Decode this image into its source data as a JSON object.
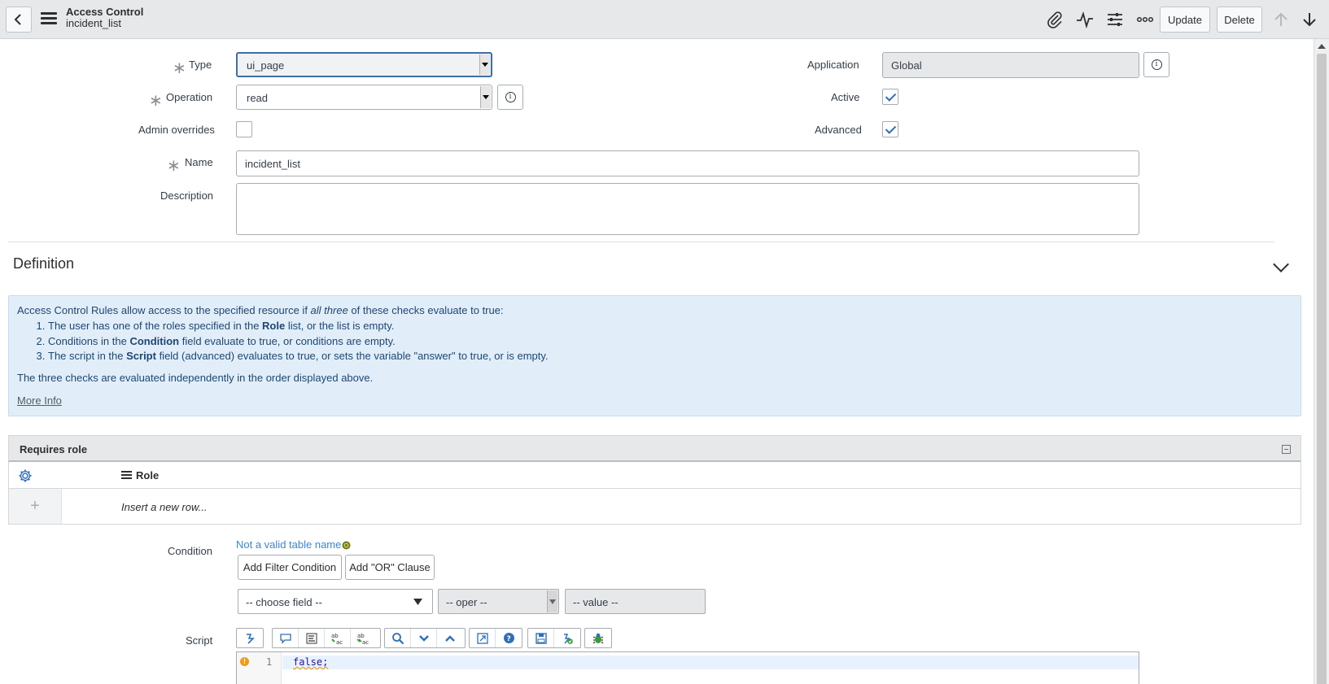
{
  "header": {
    "title": "Access Control",
    "subtitle": "incident_list",
    "update_label": "Update",
    "delete_label": "Delete"
  },
  "form": {
    "type": {
      "label": "Type",
      "value": "ui_page"
    },
    "operation": {
      "label": "Operation",
      "value": "read"
    },
    "admin_overrides": {
      "label": "Admin overrides",
      "checked": false
    },
    "name": {
      "label": "Name",
      "value": "incident_list"
    },
    "description": {
      "label": "Description",
      "value": ""
    },
    "application": {
      "label": "Application",
      "value": "Global"
    },
    "active": {
      "label": "Active",
      "checked": true
    },
    "advanced": {
      "label": "Advanced",
      "checked": true
    }
  },
  "definition": {
    "title": "Definition",
    "intro_pre": "Access Control Rules allow access to the specified resource if ",
    "intro_em": "all three",
    "intro_post": " of these checks evaluate to true:",
    "checks": [
      {
        "pre": "The user has one of the roles specified in the ",
        "bold": "Role",
        "post": " list, or the list is empty."
      },
      {
        "pre": "Conditions in the ",
        "bold": "Condition",
        "post": " field evaluate to true, or conditions are empty."
      },
      {
        "pre": "The script in the ",
        "bold": "Script",
        "post": " field (advanced) evaluates to true, or sets the variable \"answer\" to true, or is empty."
      }
    ],
    "note": "The three checks are evaluated independently in the order displayed above.",
    "more_info": "More Info"
  },
  "requires_role": {
    "title": "Requires role",
    "column": "Role",
    "insert_row": "Insert a new row..."
  },
  "condition": {
    "label": "Condition",
    "warning": "Not a valid table name",
    "add_filter": "Add Filter Condition",
    "add_or": "Add \"OR\" Clause",
    "field_placeholder": "-- choose field --",
    "oper_placeholder": "-- oper --",
    "value_placeholder": "-- value --"
  },
  "script": {
    "label": "Script",
    "line_number": "1",
    "code": "false;"
  },
  "icons": {
    "back": "back-arrow-icon",
    "menu": "hamburger-menu-icon",
    "attachment": "paperclip-icon",
    "activity": "activity-pulse-icon",
    "settings": "sliders-icon",
    "more": "more-options-icon",
    "up": "arrow-up-icon",
    "down": "arrow-down-icon"
  },
  "colors": {
    "header_bg": "#e6e8ea",
    "link_blue": "#3c86d4",
    "info_bg": "#e1eef9",
    "info_text": "#1f4670",
    "focus_border": "#3f6ea8"
  }
}
